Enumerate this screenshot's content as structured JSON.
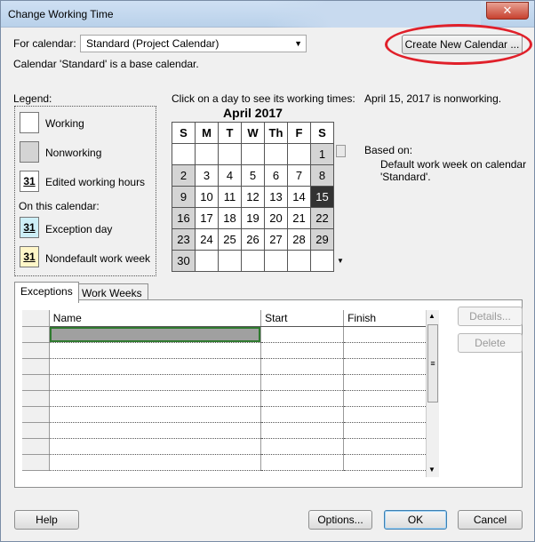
{
  "window": {
    "title": "Change Working Time",
    "close_glyph": "✕"
  },
  "for_calendar": {
    "label": "For calendar:",
    "selected": "Standard (Project Calendar)",
    "base_note": "Calendar 'Standard' is a base calendar."
  },
  "create_new_button": "Create New Calendar ...",
  "legend": {
    "title": "Legend:",
    "working": "Working",
    "nonworking": "Nonworking",
    "edited": "Edited working hours",
    "on_this_calendar": "On this calendar:",
    "exception": "Exception day",
    "nondefault": "Nondefault work week",
    "swatch_number": "31"
  },
  "calendar": {
    "instruction": "Click on a day to see its working times:",
    "month": "April 2017",
    "day_headers": [
      "S",
      "M",
      "T",
      "W",
      "Th",
      "F",
      "S"
    ],
    "weeks": [
      [
        "",
        "",
        "",
        "",
        "",
        "",
        "1"
      ],
      [
        "2",
        "3",
        "4",
        "5",
        "6",
        "7",
        "8"
      ],
      [
        "9",
        "10",
        "11",
        "12",
        "13",
        "14",
        "15"
      ],
      [
        "16",
        "17",
        "18",
        "19",
        "20",
        "21",
        "22"
      ],
      [
        "23",
        "24",
        "25",
        "26",
        "27",
        "28",
        "29"
      ],
      [
        "30",
        "",
        "",
        "",
        "",
        "",
        ""
      ]
    ],
    "selected_day": "15"
  },
  "info": {
    "status": "April 15, 2017 is nonworking.",
    "based_on_label": "Based on:",
    "based_on_text": "Default work week on calendar 'Standard'."
  },
  "tabs": [
    "Exceptions",
    "Work Weeks"
  ],
  "grid": {
    "columns": [
      "Name",
      "Start",
      "Finish"
    ]
  },
  "side_buttons": {
    "details": "Details...",
    "delete": "Delete"
  },
  "footer": {
    "help": "Help",
    "options": "Options...",
    "ok": "OK",
    "cancel": "Cancel"
  },
  "colors": {
    "nonworking": "#d4d4d4",
    "selected": "#333333",
    "accent_oval": "#e0202a"
  }
}
